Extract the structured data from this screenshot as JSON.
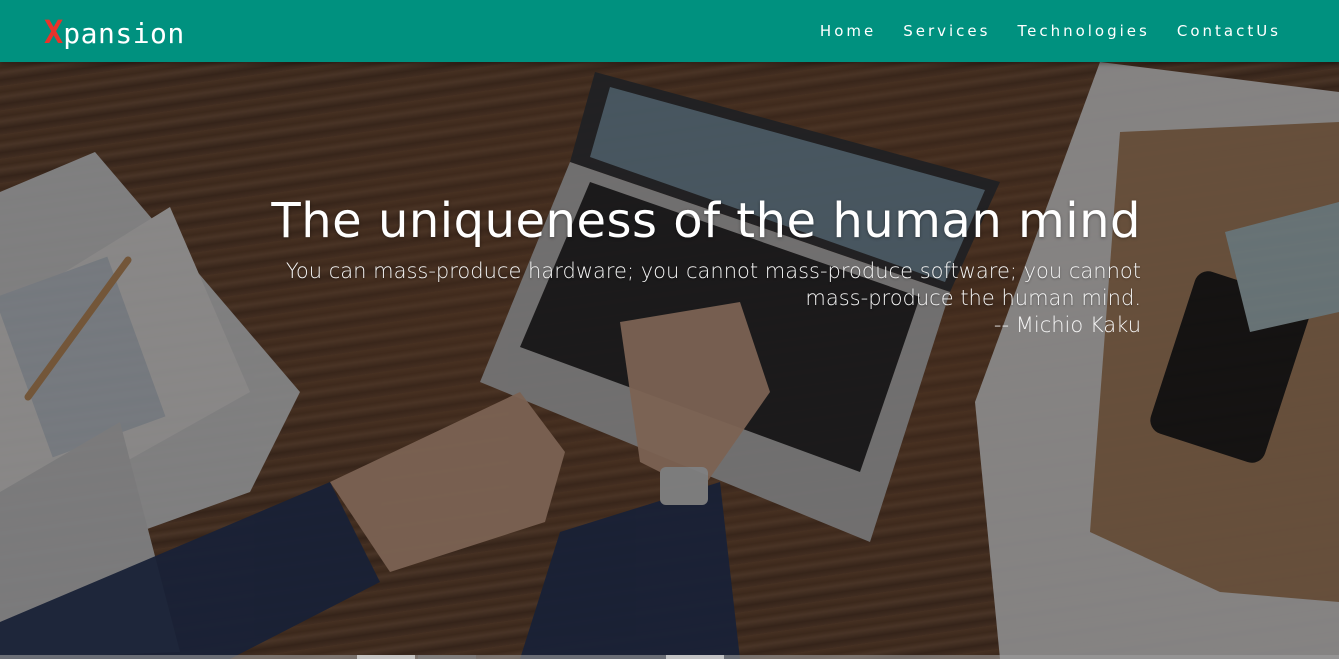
{
  "brand": {
    "logo_x": "X",
    "logo_rest": "pansion",
    "accent_color": "#e8332b",
    "navbar_color": "#00917f"
  },
  "nav": {
    "items": [
      {
        "label": "Home"
      },
      {
        "label": "Services"
      },
      {
        "label": "Technologies"
      },
      {
        "label": "ContactUs"
      }
    ]
  },
  "hero": {
    "heading": "The uniqueness of the human mind",
    "quote": "You can mass-produce hardware; you cannot mass-produce software; you cannot mass-produce the human mind.",
    "author": "-- Michio Kaku",
    "image_description_icon": "laptop-desk-photo"
  }
}
